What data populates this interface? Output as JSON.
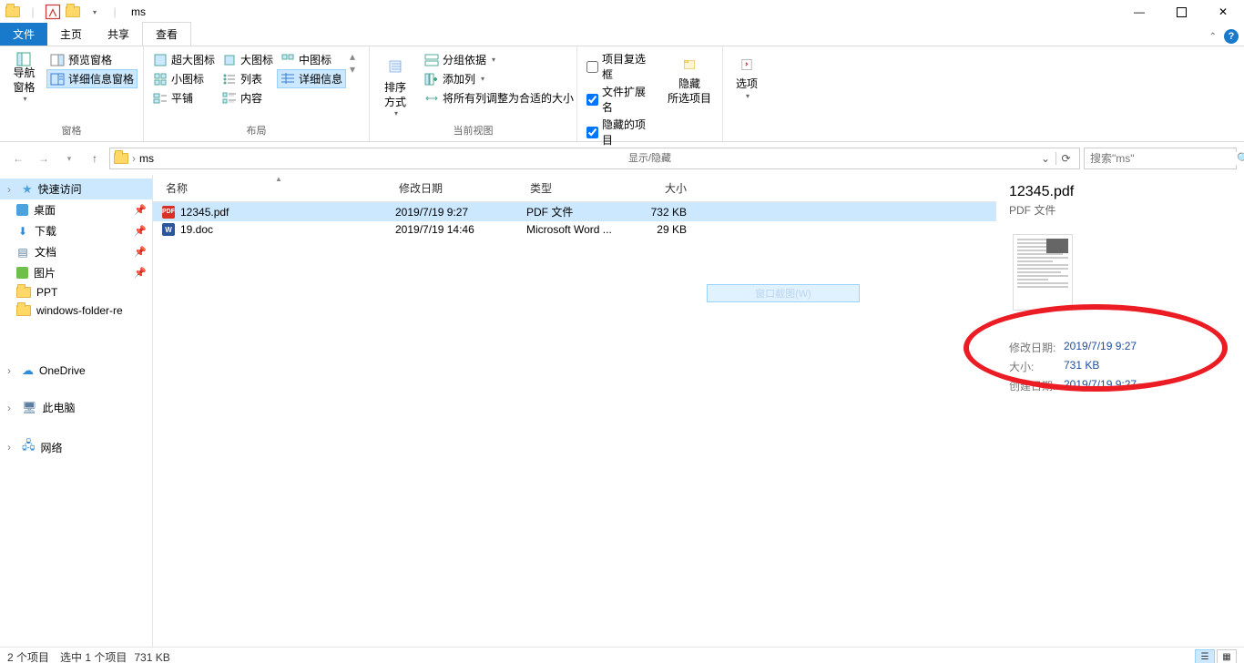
{
  "title": "ms",
  "tabs": {
    "file": "文件",
    "home": "主页",
    "share": "共享",
    "view": "查看"
  },
  "ribbon": {
    "panes": {
      "nav_pane": "导航窗格",
      "preview_pane": "预览窗格",
      "details_pane": "详细信息窗格",
      "group": "窗格"
    },
    "layout": {
      "xl": "超大图标",
      "lg": "大图标",
      "md": "中图标",
      "sm": "小图标",
      "list": "列表",
      "details": "详细信息",
      "tiles": "平铺",
      "content": "内容",
      "group": "布局"
    },
    "view": {
      "sort": "排序方式",
      "groupby": "分组依据",
      "addcol": "添加列",
      "autosize": "将所有列调整为合适的大小",
      "group": "当前视图"
    },
    "showhide": {
      "checkboxes": "项目复选框",
      "ext": "文件扩展名",
      "hidden": "隐藏的项目",
      "hide": "隐藏\n所选项目",
      "group": "显示/隐藏"
    },
    "options": "选项"
  },
  "address": {
    "folder": "ms",
    "search_ph": "搜索\"ms\""
  },
  "sidebar": {
    "quick": "快速访问",
    "desktop": "桌面",
    "downloads": "下载",
    "documents": "文档",
    "pictures": "图片",
    "ppt": "PPT",
    "wfr": "windows-folder-re",
    "onedrive": "OneDrive",
    "thispc": "此电脑",
    "network": "网络"
  },
  "list": {
    "cols": {
      "name": "名称",
      "date": "修改日期",
      "type": "类型",
      "size": "大小"
    },
    "rows": [
      {
        "icon": "pdf",
        "name": "12345.pdf",
        "date": "2019/7/19 9:27",
        "type": "PDF 文件",
        "size": "732 KB",
        "selected": true
      },
      {
        "icon": "doc",
        "name": "19.doc",
        "date": "2019/7/19 14:46",
        "type": "Microsoft Word ...",
        "size": "29 KB",
        "selected": false
      }
    ]
  },
  "snap_overlay": "窗口截图(W)",
  "details": {
    "name": "12345.pdf",
    "kind": "PDF 文件",
    "rows": [
      {
        "k": "修改日期:",
        "v": "2019/7/19 9:27"
      },
      {
        "k": "大小:",
        "v": "731 KB"
      },
      {
        "k": "创建日期:",
        "v": "2019/7/19 9:27"
      }
    ]
  },
  "status": {
    "count": "2 个项目",
    "sel": "选中 1 个项目",
    "size": "731 KB"
  }
}
